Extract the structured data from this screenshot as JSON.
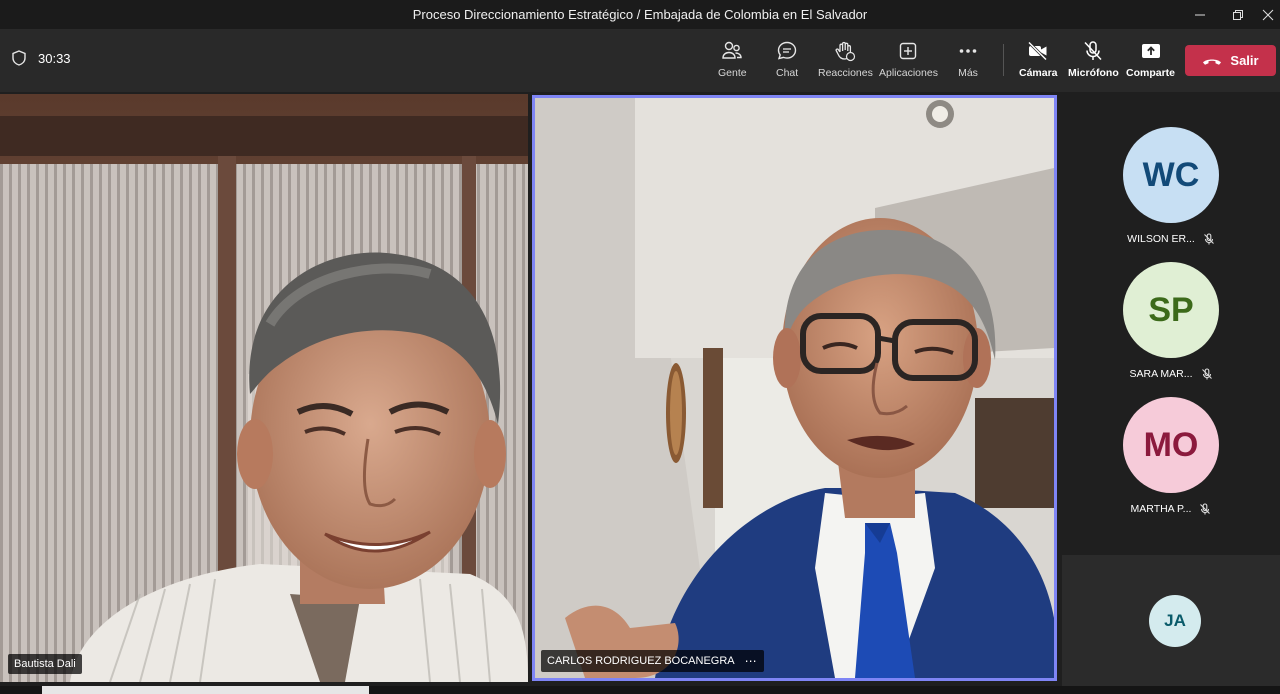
{
  "window": {
    "title": "Proceso Direccionamiento Estratégico / Embajada de Colombia en El Salvador"
  },
  "toolbar": {
    "timer": "30:33",
    "items": [
      {
        "label": "Gente",
        "icon": "people-icon"
      },
      {
        "label": "Chat",
        "icon": "chat-icon"
      },
      {
        "label": "Reacciones",
        "icon": "reactions-icon"
      },
      {
        "label": "Aplicaciones",
        "icon": "apps-icon"
      },
      {
        "label": "Más",
        "icon": "more-icon"
      },
      {
        "label": "Cámara",
        "icon": "camera-off-icon"
      },
      {
        "label": "Micrófono",
        "icon": "mic-off-icon"
      },
      {
        "label": "Comparte",
        "icon": "share-icon"
      }
    ],
    "leave_label": "Salir",
    "leave_color": "#c4314b"
  },
  "stage": {
    "left_name": "Bautista Dali",
    "right_name": "CARLOS RODRIGUEZ BOCANEGRA",
    "active_speaker_color": "#7f85f5"
  },
  "rail": {
    "participants": [
      {
        "initials": "WC",
        "name": "WILSON ER...",
        "bg": "#c7dff3",
        "fg": "#124a78"
      },
      {
        "initials": "SP",
        "name": "SARA MAR...",
        "bg": "#e0efd4",
        "fg": "#3c6a1a"
      },
      {
        "initials": "MO",
        "name": "MARTHA P...",
        "bg": "#f6cbd9",
        "fg": "#8b1a3d"
      }
    ],
    "overflow_initials": "JA"
  }
}
